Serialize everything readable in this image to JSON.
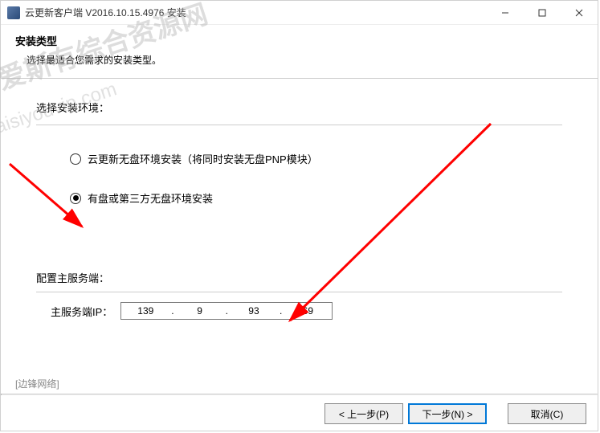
{
  "titlebar": {
    "title": "云更新客户端 V2016.10.15.4976 安装"
  },
  "header": {
    "heading": "安装类型",
    "subheading": "选择最适合您需求的安装类型。"
  },
  "env": {
    "group_label": "选择安装环境：",
    "option1": "云更新无盘环境安装（将同时安装无盘PNP模块）",
    "option2": "有盘或第三方无盘环境安装",
    "selected": 2
  },
  "config": {
    "group_label": "配置主服务端：",
    "ip_label": "主服务端IP：",
    "ip": [
      "139",
      "9",
      "93",
      "69"
    ]
  },
  "footer": {
    "branding": "[边锋网络]",
    "back": "< 上一步(P)",
    "next": "下一步(N) >",
    "cancel": "取消(C)"
  },
  "watermark": {
    "line1": "爱斯有综合资源网",
    "line2": "aisiyouvip.com"
  }
}
